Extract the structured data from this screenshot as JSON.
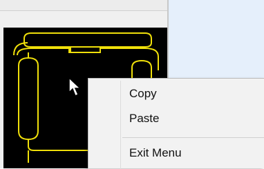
{
  "context_menu": {
    "items": [
      {
        "label": "Copy"
      },
      {
        "label": "Paste"
      },
      {
        "label": "Exit Menu"
      }
    ]
  },
  "colors": {
    "canvas_bg": "#000000",
    "diagram_stroke": "#f0e00a",
    "menu_bg": "#f2f2f2",
    "desktop_bg": "#e5effb"
  },
  "icons": {
    "cursor": "arrow-cursor-icon"
  }
}
